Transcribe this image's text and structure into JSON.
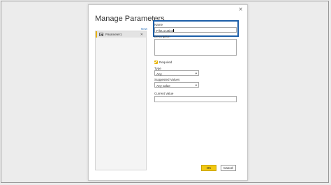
{
  "dialog": {
    "title": "Manage Parameters",
    "close_symbol": "✕",
    "new_label": "New",
    "ok_label": "OK",
    "cancel_label": "Cancel"
  },
  "parameters": {
    "items": [
      {
        "label": "Parameter1",
        "remove_symbol": "✕",
        "icon": "table-icon"
      }
    ]
  },
  "form": {
    "name_label": "Name",
    "name_value": "FileLocation",
    "description_label": "Description",
    "description_value": "",
    "required_label": "Required",
    "required_checked": true,
    "type_label": "Type",
    "type_value": "Any",
    "suggested_values_label": "Suggested Values",
    "suggested_values_value": "Any value",
    "current_value_label": "Current Value",
    "current_value_value": ""
  },
  "colors": {
    "accent_yellow": "#f2c811",
    "focus_blue": "#1c5ea8",
    "link_blue": "#3b7bbf"
  }
}
